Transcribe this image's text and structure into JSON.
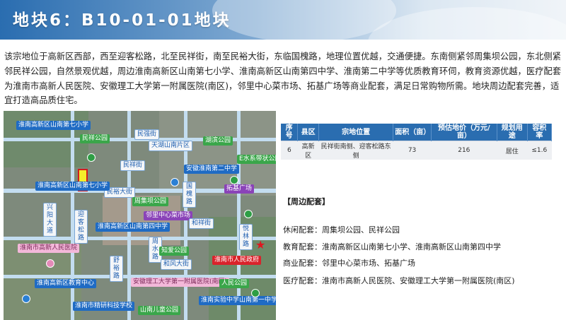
{
  "header": {
    "title": "地块6：B10-01-01地块"
  },
  "description": "该宗地位于高新区西部，西至迎客松路，北至民祥街，南至民裕大街，东临国槐路，地理位置优越，交通便捷。东南侧紧邻周集坝公园，东北侧紧邻民祥公园，自然景观优越，周边淮南高新区山南第七小学、淮南高新区山南第四中学、淮南第二中学等优质教育环伺，教育资源优越，医疗配套为淮南市高新人民医院、安徽理工大学第一附属医院(南区)，邻里中心菜市场、拓基广场等商业配套，满足日常购物所需。地块周边配套完善，适宜打造高品质住宅。",
  "map": {
    "labels": {
      "school7": "淮南高新区山南第七小学",
      "minxiang_park": "民祥公园",
      "minjie": "民强街",
      "tianshili": "天湖山南片区",
      "minzhou_school": "淮南高新区山南第七小学",
      "shuanghe_park": "湖滨公园",
      "minxiang_street": "民祥街",
      "anhui_school": "安徽淮南第二中学",
      "e_park": "E水系带状公园",
      "minyu_street": "民裕大街",
      "guohuai_road": "国槐路",
      "zhouji_park": "周集坝公园",
      "neighborhood": "邻里中心菜市场",
      "tuoji": "拓基广场",
      "school4": "淮南高新区山南第四中学",
      "hexiang_street": "和祥街",
      "zhoushui": "周水路",
      "yingkesong": "迎客松路",
      "hospital": "淮南市高新人民医院",
      "zhiai_park": "知爱公园",
      "hefeng_street": "和风大街",
      "gov": "淮南市人民政府",
      "anli_hospital": "安徽理工大学第一附属医院(南区)",
      "jiaoyu": "淮南高新区教育中心",
      "renmin_park": "人民公园",
      "science_school": "淮南市精研科技学校",
      "ertong_park": "山南儿童公园",
      "shiyan": "淮南实验中学山南第一中学(高分校区)",
      "xingyang": "兴阳大道",
      "qiaoling": "桥梁路",
      "shuyu": "舒裕路",
      "yuelin": "悦林路"
    }
  },
  "table": {
    "headers": [
      "序号",
      "县区",
      "宗地位置",
      "面积（亩）",
      "预估地价（万元/亩）",
      "规划用途",
      "容积率"
    ],
    "rows": [
      [
        "6",
        "高新区",
        "民祥街南侧、迎客松路东侧",
        "73",
        "216",
        "居住",
        "≤1.6"
      ]
    ]
  },
  "around": {
    "title": "【周边配套】",
    "items": [
      {
        "label": "休闲配套：",
        "value": "周集坝公园、民祥公园"
      },
      {
        "label": "教育配套：",
        "value": "淮南高新区山南第七小学、淮南高新区山南第四中学"
      },
      {
        "label": "商业配套：",
        "value": "邻里中心菜市场、拓基广场"
      },
      {
        "label": "医疗配套：",
        "value": "淮南市高新人民医院、安徽理工大学第一附属医院(南区)"
      }
    ]
  },
  "colors": {
    "accent": "#2a6db0",
    "site_fill": "#f6ee2a",
    "site_border": "#d21c1c",
    "gov_star": "#e0161e"
  }
}
